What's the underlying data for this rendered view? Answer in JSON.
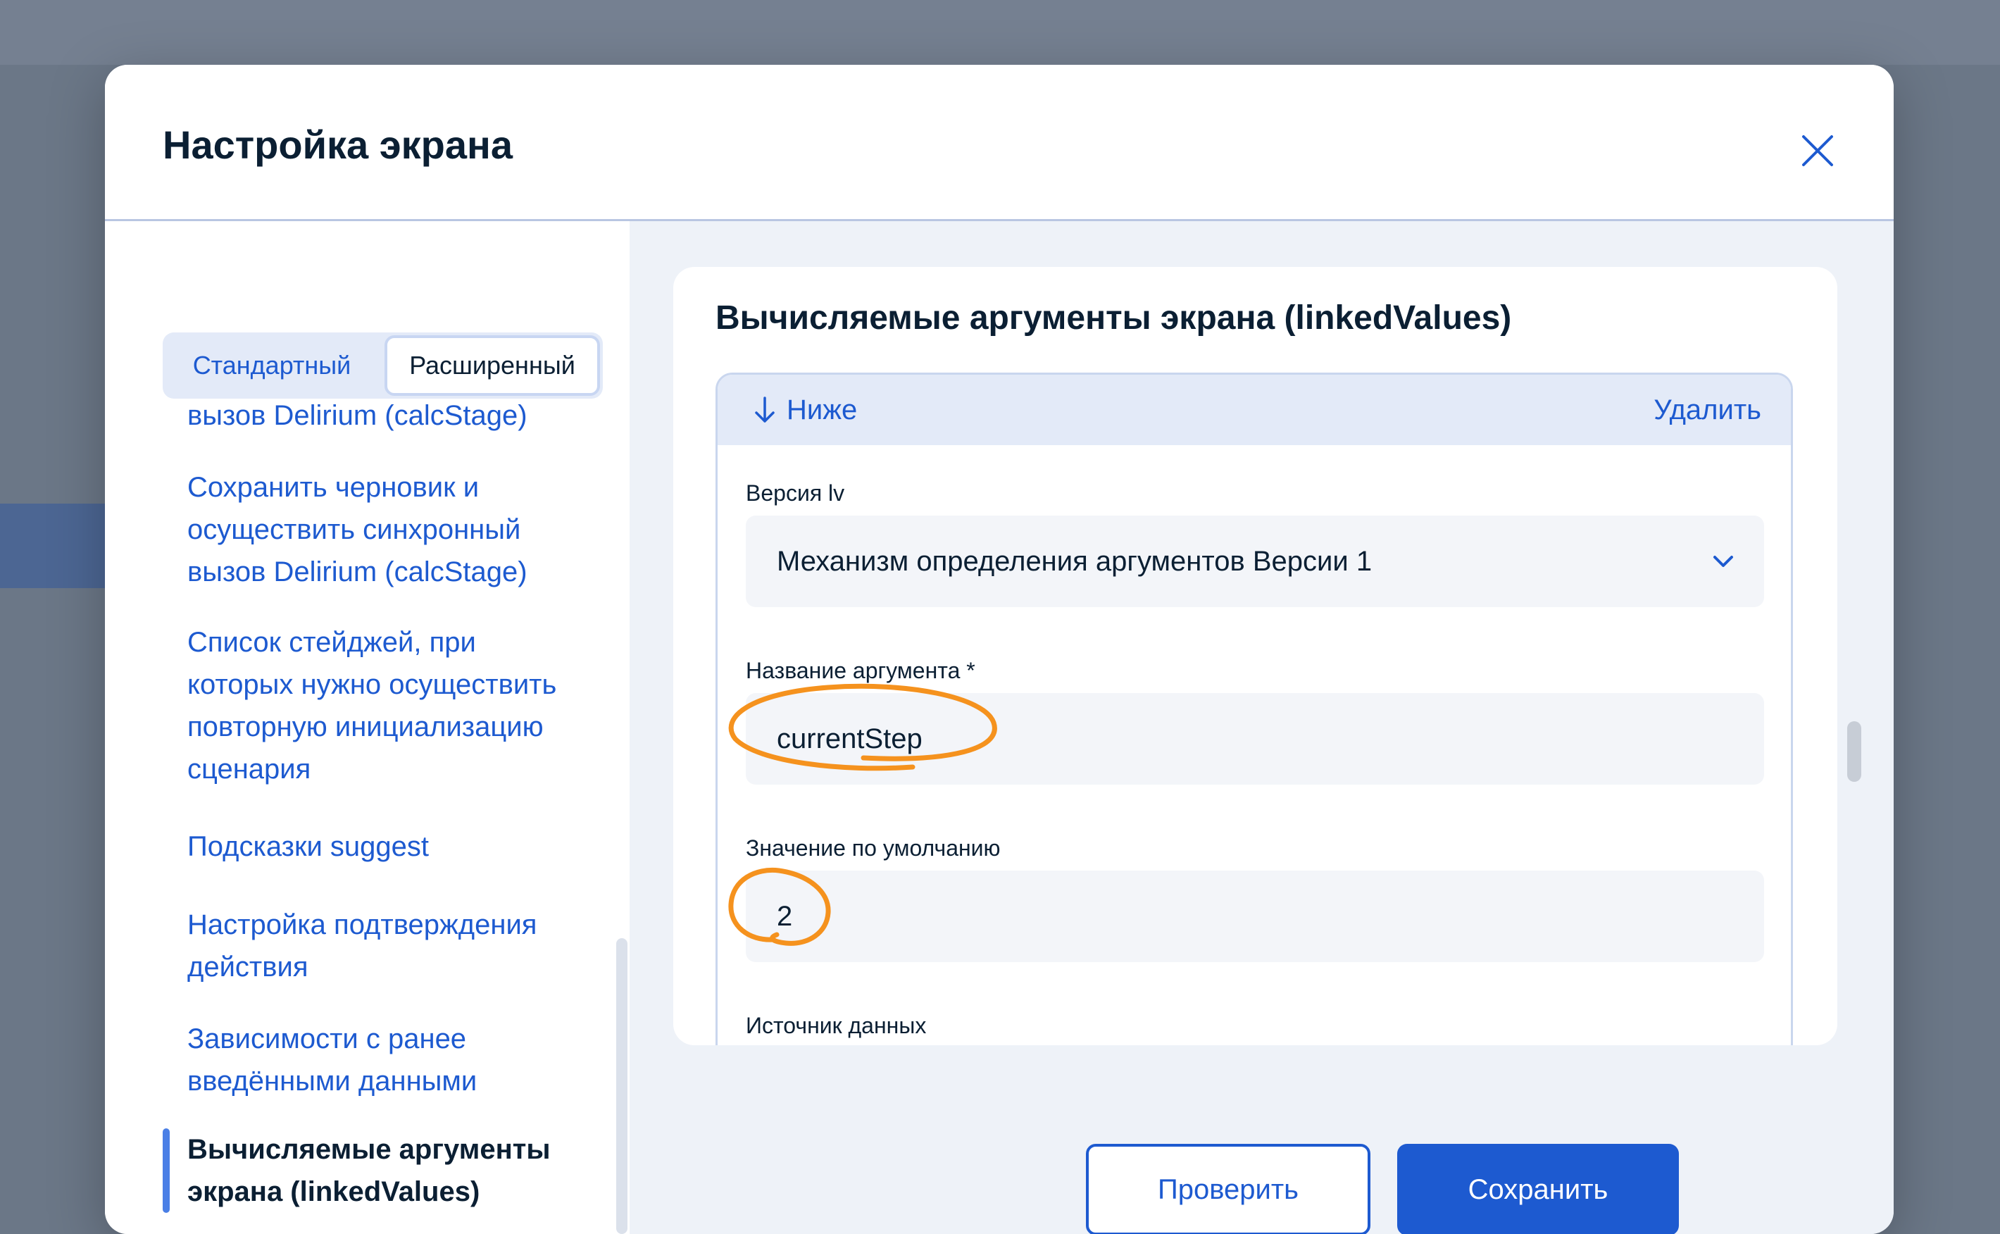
{
  "modal": {
    "title": "Настройка экрана",
    "close_icon": "close-icon"
  },
  "sidebar": {
    "mode_toggle": {
      "options": [
        "Стандартный",
        "Расширенный"
      ],
      "selected": "Расширенный"
    },
    "items": [
      {
        "label": "вызов Delirium (calcStage)"
      },
      {
        "label": "Сохранить черновик и осуществить синхронный вызов Delirium (calcStage)"
      },
      {
        "label": "Список стейджей, при которых нужно осуществить повторную инициализацию сценария"
      },
      {
        "label": "Подсказки suggest"
      },
      {
        "label": "Настройка подтверждения действия"
      },
      {
        "label": "Зависимости с ранее введёнными данными"
      },
      {
        "label": "Вычисляемые аргументы экрана (linkedValues)",
        "active": true
      }
    ]
  },
  "content": {
    "card_title": "Вычисляемые аргументы экрана (linkedValues)",
    "argument": {
      "move_label": "Ниже",
      "move_icon": "arrow-down-icon",
      "delete_label": "Удалить",
      "fields": {
        "version": {
          "label": "Версия lv",
          "value": "Механизм определения аргументов Версии 1",
          "icon": "chevron-down-icon"
        },
        "name": {
          "label": "Название аргумента *",
          "value": "currentStep"
        },
        "default": {
          "label": "Значение по умолчанию",
          "value": "2"
        },
        "source": {
          "label": "Источник данных"
        }
      }
    },
    "buttons": {
      "check": "Проверить",
      "save": "Сохранить"
    }
  },
  "colors": {
    "accent": "#1d5ad0",
    "annotation": "#f5921e",
    "text": "#0b1f33",
    "panel_bg": "#eef2f8"
  }
}
